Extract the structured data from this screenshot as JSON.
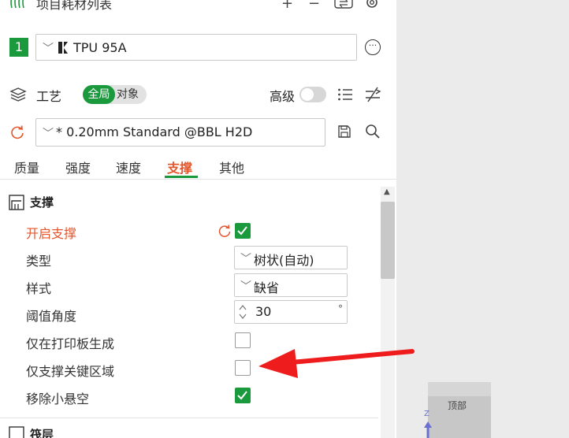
{
  "header": {
    "title": "项目耗材列表",
    "icons": [
      "filament-spool-icon",
      "add-icon",
      "remove-icon",
      "sync-icon",
      "gear-icon"
    ]
  },
  "filament": {
    "slot_number": "1",
    "name": "TPU 95A",
    "color": "#1a9a3c"
  },
  "process": {
    "title": "工艺",
    "scope_global": "全局",
    "scope_object": "对象",
    "advanced_label": "高级",
    "advanced_enabled": false
  },
  "preset": {
    "name": "* 0.20mm Standard @BBL H2D"
  },
  "tabs": [
    {
      "label": "质量",
      "active": false
    },
    {
      "label": "强度",
      "active": false
    },
    {
      "label": "速度",
      "active": false
    },
    {
      "label": "支撑",
      "active": true
    },
    {
      "label": "其他",
      "active": false
    }
  ],
  "support_section": {
    "title": "支撑",
    "enable_support": {
      "label": "开启支撑",
      "checked": true,
      "modified": true
    },
    "type": {
      "label": "类型",
      "value": "树状(自动)"
    },
    "style": {
      "label": "样式",
      "value": "缺省"
    },
    "threshold_angle": {
      "label": "阈值角度",
      "value": "30",
      "unit": "°"
    },
    "on_build_plate_only": {
      "label": "仅在打印板生成",
      "checked": false
    },
    "critical_regions_only": {
      "label": "仅支撑关键区域",
      "checked": false
    },
    "remove_small_overhangs": {
      "label": "移除小悬空",
      "checked": true
    }
  },
  "raft_section": {
    "title": "筏层"
  },
  "view_cube": {
    "top_label": "顶部",
    "axis_label": "Z"
  },
  "colors": {
    "accent_green": "#1a9a3c",
    "accent_orange": "#e4562b",
    "annotation_red": "#ee1c1c"
  }
}
